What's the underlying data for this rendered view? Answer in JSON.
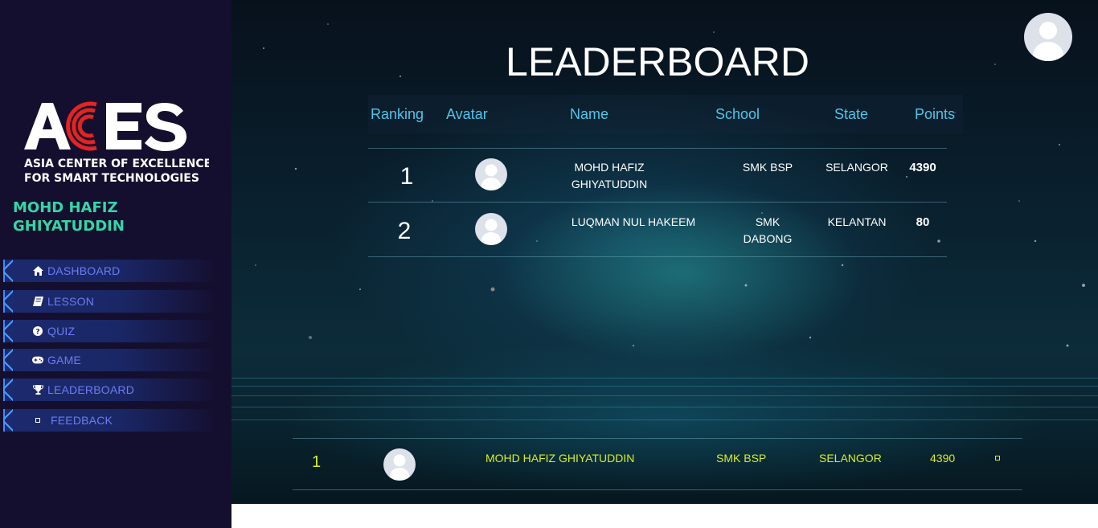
{
  "brand": {
    "logo_main": "ACES",
    "logo_line1": "ASIA CENTER OF EXCELLENCE",
    "logo_line2": "FOR SMART TECHNOLOGIES",
    "accent_color": "#e52320"
  },
  "sidebar": {
    "user_name": "MOHD HAFIZ GHIYATUDDIN",
    "items": [
      {
        "label": "DASHBOARD",
        "icon": "home-icon"
      },
      {
        "label": "LESSON",
        "icon": "book-icon"
      },
      {
        "label": "QUIZ",
        "icon": "question-circle-icon"
      },
      {
        "label": "GAME",
        "icon": "gamepad-icon"
      },
      {
        "label": "LEADERBOARD",
        "icon": "trophy-icon"
      },
      {
        "label": "FEEDBACK",
        "icon": "feedback-icon"
      }
    ]
  },
  "page": {
    "title": "LEADERBOARD"
  },
  "table": {
    "headers": [
      "Ranking",
      "Avatar",
      "Name",
      "School",
      "State",
      "Points"
    ],
    "rows": [
      {
        "rank": "1",
        "name": "MOHD HAFIZ GHIYATUDDIN",
        "school": "SMK BSP",
        "state": "SELANGOR",
        "points": "4390"
      },
      {
        "rank": "2",
        "name": "LUQMAN NUL HAKEEM",
        "school": "SMK DABONG",
        "state": "KELANTAN",
        "points": "80"
      }
    ]
  },
  "current_user_row": {
    "rank": "1",
    "name": "MOHD HAFIZ GHIYATUDDIN",
    "school": "SMK BSP",
    "state": "SELANGOR",
    "points": "4390"
  },
  "colors": {
    "sidebar_bg": "#150f2f",
    "user_name": "#35d6a6",
    "nav_label": "#6d7cf3",
    "header_text": "#4fc6e8",
    "highlight_row": "#d9ee1c"
  }
}
